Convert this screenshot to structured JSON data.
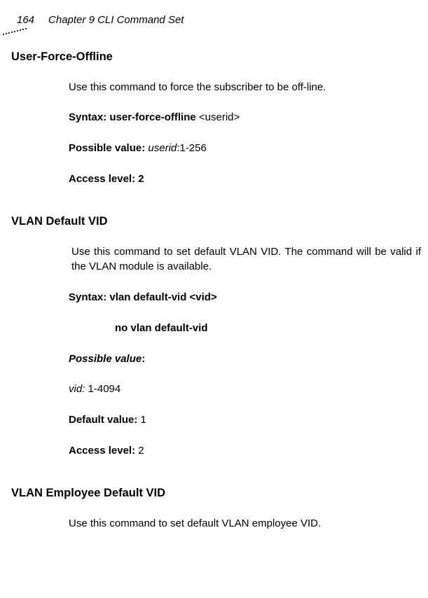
{
  "header": {
    "page_number": "164",
    "chapter": "Chapter 9 CLI Command Set"
  },
  "section1": {
    "title": "User-Force-Offline",
    "desc": "Use this command to force the subscriber to be off-line.",
    "syntax_label": "Syntax: user-force-offline ",
    "syntax_arg": "<userid>",
    "pv_label": "Possible value: ",
    "pv_userid": "userid",
    "pv_rest": ":1-256",
    "access": "Access level: 2"
  },
  "section2": {
    "title": "VLAN Default VID",
    "desc": "Use this command to set default VLAN VID. The command will be valid if the VLAN module is available.",
    "syntax1": "Syntax: vlan default-vid <vid>",
    "syntax2": "no vlan default-vid",
    "pv_label": "Possible value",
    "pv_colon": ":",
    "vid_label": "vid: ",
    "vid_value": "1-4094",
    "dv_label": "Default value: ",
    "dv_value": "1",
    "al_label": "Access level: ",
    "al_value": "2"
  },
  "section3": {
    "title": "VLAN Employee Default VID",
    "desc": "Use this command to set default VLAN employee VID."
  }
}
